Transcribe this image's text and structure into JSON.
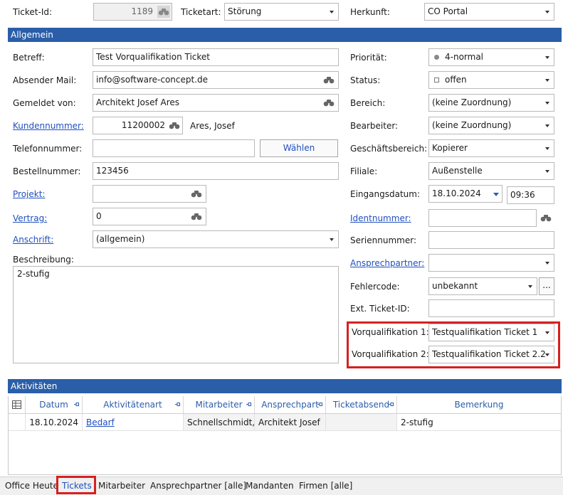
{
  "header": {
    "ticket_id_label": "Ticket-Id:",
    "ticket_id_value": "1189",
    "ticketart_label": "Ticketart:",
    "ticketart_value": "Störung",
    "herkunft_label": "Herkunft:",
    "herkunft_value": "CO Portal"
  },
  "allgemein": {
    "title": "Allgemein",
    "betreff_label": "Betreff:",
    "betreff_value": "Test Vorqualifikation Ticket",
    "absender_label": "Absender Mail:",
    "absender_value": "info@software-concept.de",
    "gemeldet_label": "Gemeldet von:",
    "gemeldet_value": "Architekt Josef Ares",
    "kundennummer_label": "Kundennummer:",
    "kundennummer_value": "11200002",
    "kunde_name": "Ares, Josef",
    "telefon_label": "Telefonnummer:",
    "telefon_value": "",
    "waehlen_button": "Wählen",
    "bestell_label": "Bestellnummer:",
    "bestell_value": "123456",
    "projekt_label": "Projekt:",
    "projekt_value": "",
    "vertrag_label": "Vertrag:",
    "vertrag_value": "0",
    "anschrift_label": "Anschrift:",
    "anschrift_value": "(allgemein)",
    "beschreibung_label": "Beschreibung:",
    "beschreibung_value": "2-stufig",
    "prioritaet_label": "Priorität:",
    "prioritaet_value": "4-normal",
    "status_label": "Status:",
    "status_value": "offen",
    "bereich_label": "Bereich:",
    "bereich_value": "(keine Zuordnung)",
    "bearbeiter_label": "Bearbeiter:",
    "bearbeiter_value": "(keine Zuordnung)",
    "geschaeftsbereich_label": "Geschäftsbereich:",
    "geschaeftsbereich_value": "Kopierer",
    "filiale_label": "Filiale:",
    "filiale_value": "Außenstelle",
    "eingangsdatum_label": "Eingangsdatum:",
    "eingangsdatum_value": "18.10.2024",
    "eingangszeit_value": "09:36",
    "identnummer_label": "Identnummer:",
    "identnummer_value": "",
    "seriennummer_label": "Seriennummer:",
    "seriennummer_value": "",
    "ansprechpartner_label": "Ansprechpartner:",
    "ansprechpartner_value": "",
    "fehlercode_label": "Fehlercode:",
    "fehlercode_value": "unbekannt",
    "fehlercode_button": "...",
    "extticket_label": "Ext. Ticket-ID:",
    "extticket_value": "",
    "vorq1_label": "Vorqualifikation 1:",
    "vorq1_value": "Testqualifikation Ticket 1",
    "vorq2_label": "Vorqualifikation 2:",
    "vorq2_value": "Testqualifikation Ticket 2.2"
  },
  "aktivitaeten": {
    "title": "Aktivitäten",
    "columns": [
      "Datum",
      "Aktivitätenart",
      "Mitarbeiter",
      "Ansprechpart",
      "Ticketabsend",
      "Bemerkung"
    ],
    "rows": [
      {
        "datum": "18.10.2024",
        "art": "Bedarf",
        "mitarbeiter": "Schnellschmidt,",
        "ansprechpartner": "Architekt Josef",
        "ticketabsender": "",
        "bemerkung": "2-stufig"
      }
    ]
  },
  "bottom_tabs": [
    "Office Heute",
    "Tickets",
    "Mitarbeiter",
    "Ansprechpartner [alle]",
    "Mandanten",
    "Firmen [alle]"
  ],
  "colors": {
    "section_bar": "#2a5ea8",
    "link": "#1f4fbf",
    "highlight": "#d62020"
  }
}
